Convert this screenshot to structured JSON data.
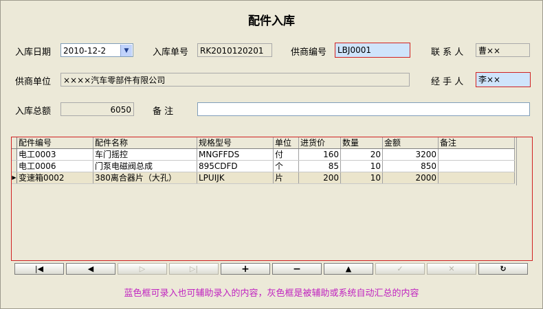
{
  "title": "配件入库",
  "form": {
    "date_label": "入库日期",
    "date_value": "2010-12-2",
    "order_label": "入库单号",
    "order_value": "RK2010120201",
    "supplier_code_label": "供商编号",
    "supplier_code_value": "LBJ0001",
    "contact_label": "联 系 人",
    "contact_value": "曹××",
    "supplier_unit_label": "供商单位",
    "supplier_unit_value": "××××汽车零部件有限公司",
    "handler_label": "经 手 人",
    "handler_value": "李××",
    "total_label": "入库总额",
    "total_value": "6050",
    "remark_label": "备  注",
    "remark_value": ""
  },
  "grid": {
    "columns": [
      "配件编号",
      "配件名称",
      "规格型号",
      "单位",
      "进货价",
      "数量",
      "金额",
      "备注"
    ],
    "rows": [
      [
        "电工0003",
        "车门摇控",
        "MNGFFDS",
        "付",
        "160",
        "20",
        "3200",
        ""
      ],
      [
        "电工0006",
        "门泵电磁阀总成",
        "895CDFD",
        "个",
        "85",
        "10",
        "850",
        ""
      ],
      [
        "变速箱0002",
        "380离合器片（大孔）",
        "LPUIJK",
        "片",
        "200",
        "10",
        "2000",
        ""
      ]
    ],
    "selected_row": 2
  },
  "toolbar": {
    "first": "first-record-icon",
    "prev": "prev-record-icon",
    "next": "next-record-icon",
    "last": "last-record-icon",
    "add": "add-icon",
    "delete": "delete-icon",
    "edit": "edit-icon",
    "post": "post-icon",
    "cancel": "cancel-icon",
    "refresh": "refresh-icon"
  },
  "hint": "蓝色框可录入也可辅助录入的内容，灰色框是被辅助或系统自动汇总的内容",
  "colors": {
    "editable_bg": "#cfe4fb",
    "readonly_bg": "#ece9d8",
    "highlight_border": "#d02020",
    "hint_text": "#c023c0"
  }
}
